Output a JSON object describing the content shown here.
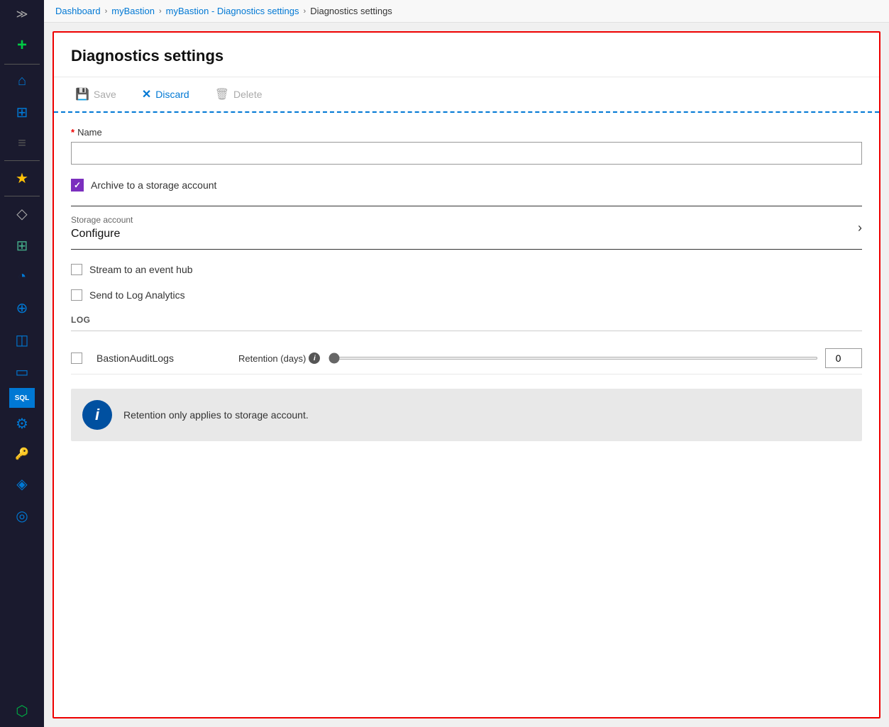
{
  "breadcrumb": {
    "items": [
      {
        "label": "Dashboard",
        "href": "#"
      },
      {
        "label": "myBastion",
        "href": "#"
      },
      {
        "label": "myBastion - Diagnostics settings",
        "href": "#"
      },
      {
        "label": "Diagnostics settings",
        "current": true
      }
    ]
  },
  "page": {
    "title": "Diagnostics settings"
  },
  "toolbar": {
    "save_label": "Save",
    "discard_label": "Discard",
    "delete_label": "Delete"
  },
  "form": {
    "name_label": "Name",
    "name_placeholder": "",
    "name_required": true,
    "archive_label": "Archive to a storage account",
    "archive_checked": true,
    "storage_section_label": "Storage account",
    "storage_configure_label": "Configure",
    "stream_label": "Stream to an event hub",
    "stream_checked": false,
    "log_analytics_label": "Send to Log Analytics",
    "log_analytics_checked": false
  },
  "log_section": {
    "header": "LOG",
    "rows": [
      {
        "name": "BastionAuditLogs",
        "checked": false,
        "retention_label": "Retention (days)",
        "retention_value": "0"
      }
    ]
  },
  "info_banner": {
    "message": "Retention only applies to storage account."
  },
  "sidebar": {
    "icons": [
      {
        "name": "chevron-right",
        "symbol": "≫"
      },
      {
        "name": "plus",
        "symbol": "+"
      },
      {
        "name": "home",
        "symbol": "⌂"
      },
      {
        "name": "dashboard",
        "symbol": "⊞"
      },
      {
        "name": "menu",
        "symbol": "≡"
      },
      {
        "name": "favorites",
        "symbol": "★"
      },
      {
        "name": "resources",
        "symbol": "◇"
      },
      {
        "name": "grid",
        "symbol": "⊞"
      },
      {
        "name": "clock",
        "symbol": "○"
      },
      {
        "name": "globe",
        "symbol": "⊕"
      },
      {
        "name": "box",
        "symbol": "◫"
      },
      {
        "name": "monitor",
        "symbol": "▭"
      },
      {
        "name": "sql",
        "symbol": "SQL"
      },
      {
        "name": "settings",
        "symbol": "⚙"
      },
      {
        "name": "key",
        "symbol": "🔑"
      },
      {
        "name": "network",
        "symbol": "◈"
      },
      {
        "name": "gauge",
        "symbol": "◎"
      },
      {
        "name": "shield",
        "symbol": "⬡"
      }
    ]
  }
}
